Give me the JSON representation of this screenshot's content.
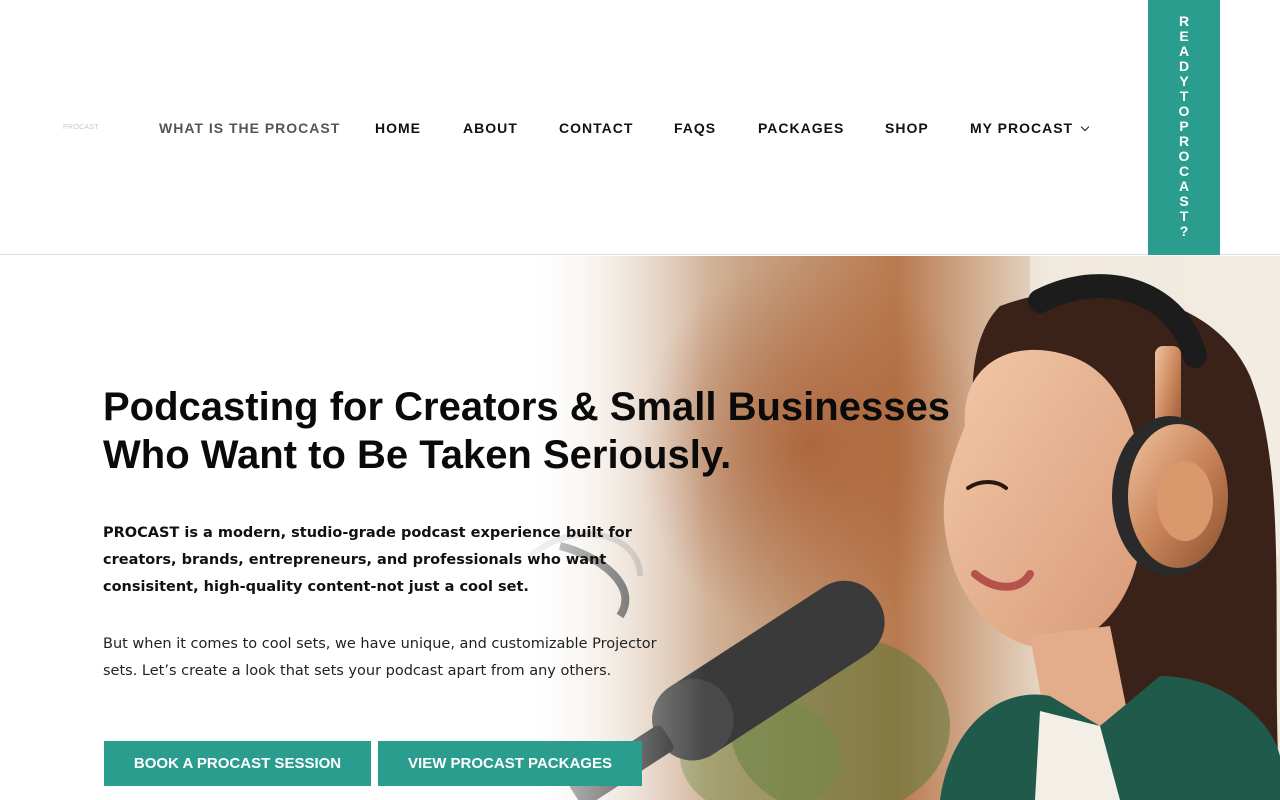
{
  "header": {
    "logo_text": "PROCAST",
    "nav": [
      {
        "label": "WHAT IS THE PROCAST"
      },
      {
        "label": "HOME"
      },
      {
        "label": "ABOUT"
      },
      {
        "label": "CONTACT"
      },
      {
        "label": "FAQS"
      },
      {
        "label": "PACKAGES"
      },
      {
        "label": "SHOP"
      },
      {
        "label": "MY PROCAST"
      }
    ],
    "ready_tab_text": "READYTOPROCAST?"
  },
  "hero": {
    "title_line1": "Podcasting for Creators & Small Businesses",
    "title_line2": "Who Want to Be Taken Seriously.",
    "paragraph1": "PROCAST is a modern, studio-grade podcast experience built for creators, brands, entrepreneurs, and professionals who want consisitent, high-quality content-not just a cool set.",
    "paragraph2": "But when it comes to cool sets, we have unique, and customizable Projector sets.  Let’s create a look that sets your podcast apart from any others.",
    "button_book": "BOOK A PROCAST SESSION",
    "button_packages": "VIEW PROCAST PACKAGES",
    "photo": "woman-with-headphones-and-microphone"
  },
  "colors": {
    "accent": "#2a9d8f",
    "text": "#111111",
    "nav_active": "#555555"
  }
}
